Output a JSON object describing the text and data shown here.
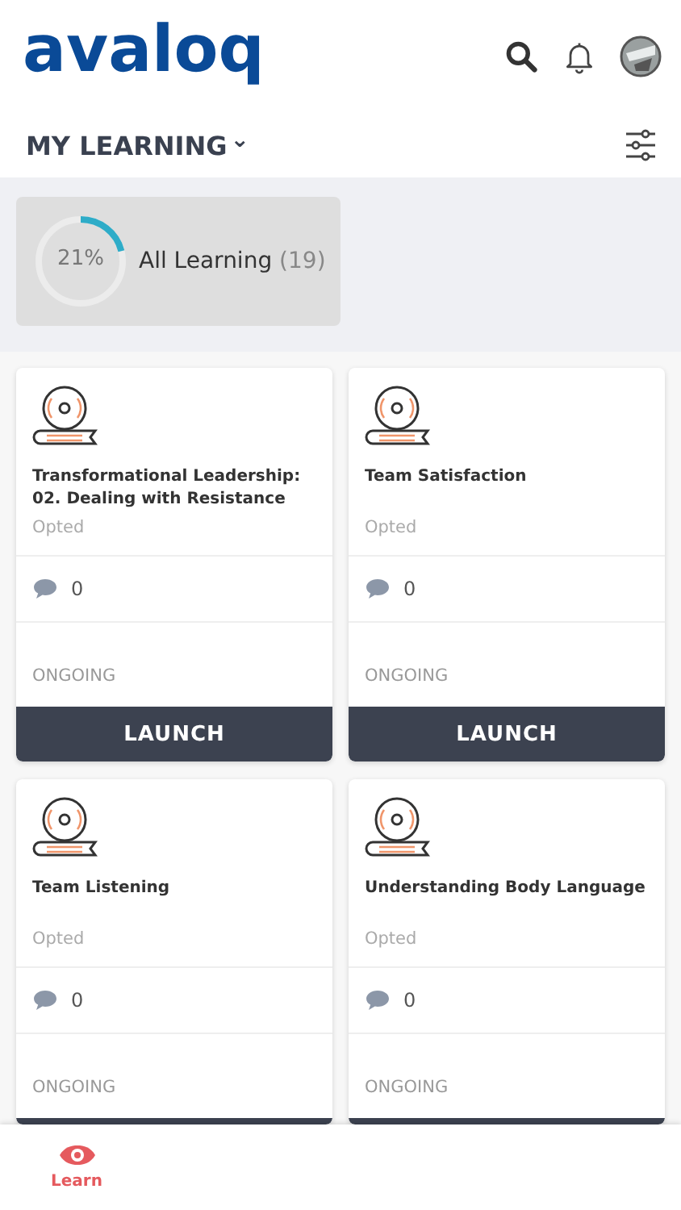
{
  "header": {
    "logo": "avaloq"
  },
  "title_bar": {
    "title": "MY LEARNING",
    "dropdown": "⌄"
  },
  "summary": {
    "percent": "21%",
    "level": 0.21,
    "label": "All Learning",
    "count": "(19)"
  },
  "courses": [
    {
      "title": "Transformational Leadership: 02. Dealing with Resistance",
      "enrollment": "Opted",
      "comments": "0",
      "status": "ONGOING",
      "button": "LAUNCH"
    },
    {
      "title": "Team Satisfaction",
      "enrollment": "Opted",
      "comments": "0",
      "status": "ONGOING",
      "button": "LAUNCH"
    },
    {
      "title": "Team Listening",
      "enrollment": "Opted",
      "comments": "0",
      "status": "ONGOING"
    },
    {
      "title": "Understanding Body Language",
      "enrollment": "Opted",
      "comments": "0",
      "status": "ONGOING"
    }
  ],
  "bottom_nav": [
    {
      "label": "Learn",
      "selected": true
    }
  ]
}
